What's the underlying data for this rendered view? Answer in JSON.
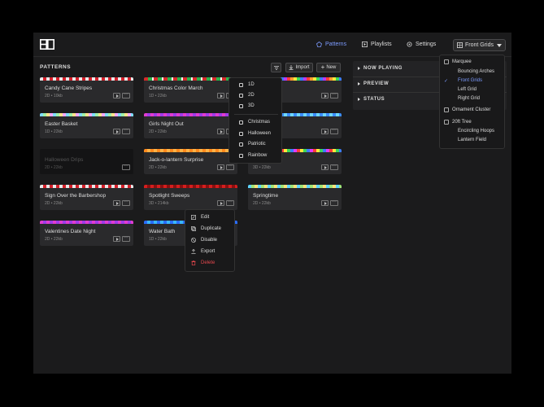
{
  "nav": {
    "items": [
      {
        "label": "Patterns",
        "icon": "palette-icon"
      },
      {
        "label": "Playlists",
        "icon": "play-square-icon"
      },
      {
        "label": "Settings",
        "icon": "gear-icon"
      }
    ],
    "active": "Patterns",
    "context": {
      "label": "Front Grids",
      "icon": "grid-icon"
    }
  },
  "patterns": {
    "title": "PATTERNS",
    "import_label": "Import",
    "new_label": "New",
    "cards": [
      {
        "name": "Candy Cane Stripes",
        "meta": "2D • 10kb",
        "strip": "candy"
      },
      {
        "name": "Christmas Color March",
        "meta": "1D • 22kb",
        "strip": "xmas"
      },
      {
        "name": "",
        "meta": "",
        "strip": "rainbow"
      },
      {
        "name": "Easter Basket",
        "meta": "1D • 22kb",
        "strip": "pastel"
      },
      {
        "name": "Girls Night Out",
        "meta": "2D • 22kb",
        "strip": "pink"
      },
      {
        "name": "",
        "meta": "",
        "strip": "blue"
      },
      {
        "name": "Halloween Drips",
        "meta": "2D • 22kb",
        "strip": "none",
        "disabled": true
      },
      {
        "name": "Jack-o-lantern Surprise",
        "meta": "2D • 22kb",
        "strip": "orange"
      },
      {
        "name": "...erals",
        "meta": "3D • 22kb",
        "strip": "rainbow2"
      },
      {
        "name": "Sign Over the Barbershop",
        "meta": "2D • 22kb",
        "strip": "candy"
      },
      {
        "name": "Spotlight Sweeps",
        "meta": "3D • 214kb",
        "strip": "red"
      },
      {
        "name": "Springtime",
        "meta": "2D • 22kb",
        "strip": "spring"
      },
      {
        "name": "Valentines Date Night",
        "meta": "2D • 22kb",
        "strip": "pink"
      },
      {
        "name": "Water Bath",
        "meta": "1D • 22kb",
        "strip": "water"
      }
    ]
  },
  "right_panel": {
    "sections": [
      "NOW PLAYING",
      "PREVIEW",
      "STATUS"
    ]
  },
  "filter_menu": {
    "options": [
      "1D",
      "2D",
      "3D",
      "Christmas",
      "Halloween",
      "Patriotic",
      "Rainbow"
    ]
  },
  "action_menu": {
    "items": [
      {
        "label": "Edit",
        "icon": "edit-icon"
      },
      {
        "label": "Duplicate",
        "icon": "duplicate-icon"
      },
      {
        "label": "Disable",
        "icon": "disable-icon"
      },
      {
        "label": "Export",
        "icon": "export-icon"
      },
      {
        "label": "Delete",
        "icon": "trash-icon",
        "danger": true
      }
    ]
  },
  "groups_menu": {
    "items": [
      {
        "label": "Marquee",
        "level": 0
      },
      {
        "label": "Bouncing Arches",
        "level": 1
      },
      {
        "label": "Front Grids",
        "level": 1,
        "selected": true
      },
      {
        "label": "Left Grid",
        "level": 1
      },
      {
        "label": "Right Grid",
        "level": 1
      },
      {
        "label": "Ornament Cluster",
        "level": 0
      },
      {
        "label": "20ft Tree",
        "level": 0
      },
      {
        "label": "Encircling Hoops",
        "level": 1
      },
      {
        "label": "Lantern Field",
        "level": 1
      }
    ]
  },
  "colors": {
    "accent": "#7d9cff",
    "danger": "#e5484d",
    "background": "#1b1b1c",
    "card": "#2a2a2c"
  }
}
